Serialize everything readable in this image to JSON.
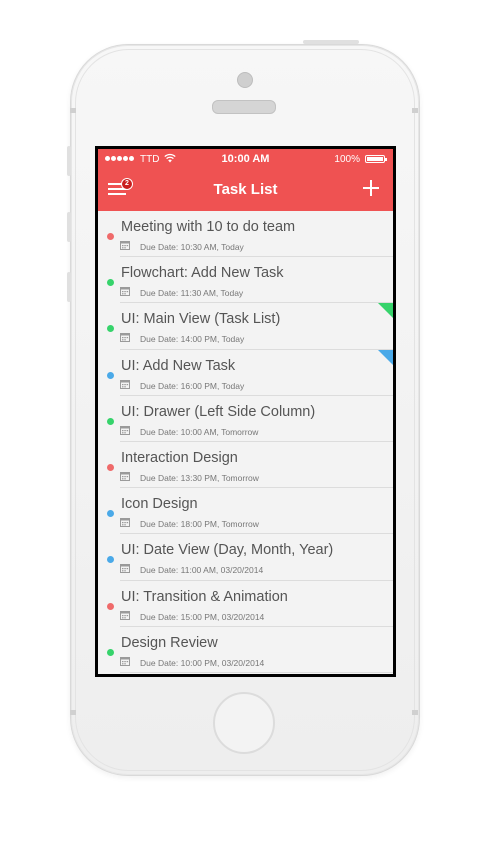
{
  "status_bar": {
    "carrier": "TTD",
    "time": "10:00 AM",
    "battery": "100%"
  },
  "nav": {
    "title": "Task List",
    "menu_badge": "2",
    "menu_icon": "hamburger-menu-icon",
    "add_icon": "plus-icon"
  },
  "colors": {
    "accent": "#ef5252",
    "red": "#ef6a6a",
    "green": "#36d36b",
    "blue": "#4aa9e8"
  },
  "tasks": [
    {
      "title": "Meeting with 10 to do team",
      "due": "Due Date: 10:30 AM, Today",
      "dot_color": "#ef6a6a",
      "corner_color": ""
    },
    {
      "title": "Flowchart: Add New Task",
      "due": "Due Date: 11:30 AM, Today",
      "dot_color": "#36d36b",
      "corner_color": ""
    },
    {
      "title": "UI: Main View (Task List)",
      "due": "Due Date: 14:00 PM, Today",
      "dot_color": "#36d36b",
      "corner_color": "#36d36b"
    },
    {
      "title": "UI: Add New Task",
      "due": "Due Date: 16:00 PM, Today",
      "dot_color": "#4aa9e8",
      "corner_color": "#4aa9e8"
    },
    {
      "title": "UI: Drawer (Left Side Column)",
      "due": "Due Date: 10:00 AM, Tomorrow",
      "dot_color": "#36d36b",
      "corner_color": ""
    },
    {
      "title": "Interaction Design",
      "due": "Due Date: 13:30 PM, Tomorrow",
      "dot_color": "#ef6a6a",
      "corner_color": ""
    },
    {
      "title": "Icon Design",
      "due": "Due Date: 18:00 PM, Tomorrow",
      "dot_color": "#4aa9e8",
      "corner_color": ""
    },
    {
      "title": "UI: Date View (Day, Month, Year)",
      "due": "Due Date: 11:00 AM, 03/20/2014",
      "dot_color": "#4aa9e8",
      "corner_color": ""
    },
    {
      "title": "UI: Transition & Animation",
      "due": "Due Date: 15:00 PM, 03/20/2014",
      "dot_color": "#ef6a6a",
      "corner_color": ""
    },
    {
      "title": "Design Review",
      "due": "Due Date: 10:00 PM, 03/20/2014",
      "dot_color": "#36d36b",
      "corner_color": ""
    }
  ]
}
